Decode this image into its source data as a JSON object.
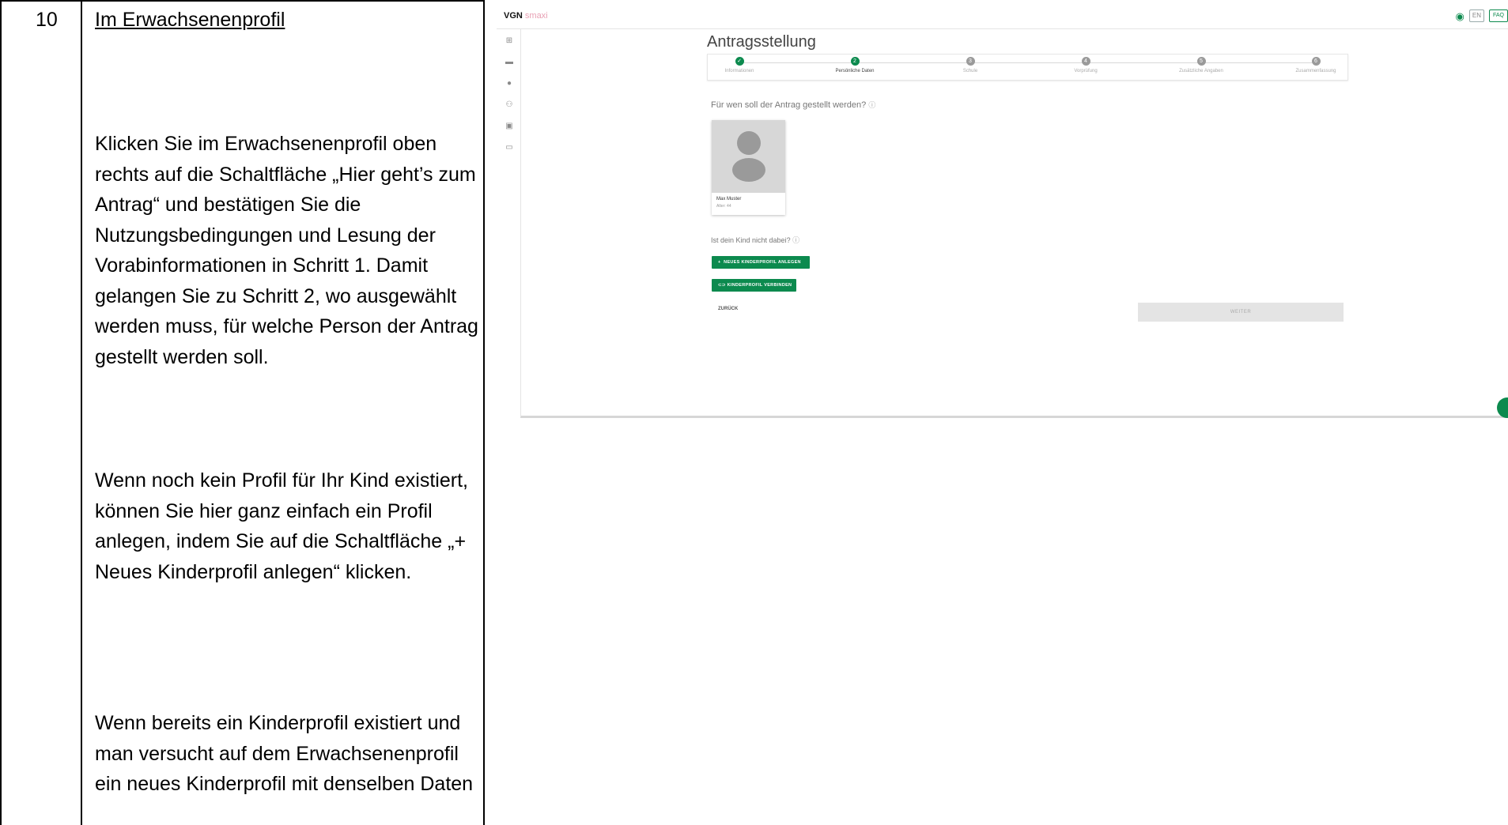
{
  "document": {
    "step_number": "10",
    "step_title": "Im Erwachsenenprofil",
    "paragraphs": [
      "Klicken Sie im Erwachsenenprofil oben rechts auf die Schaltfläche „Hier geht’s zum Antrag“ und bestätigen Sie die Nutzungsbedingungen und Lesung der Vorabinformationen in Schritt 1. Damit gelangen Sie zu Schritt 2, wo ausgewählt werden muss, für welche Person der Antrag gestellt werden soll.",
      "Wenn noch kein Profil für Ihr Kind existiert, können Sie hier ganz einfach ein Profil anlegen, indem Sie auf die Schaltfläche „+ Neues Kinderprofil anlegen“ klicken.",
      "Wenn bereits ein Kinderprofil existiert und man versucht auf dem Erwachsenenprofil ein neues Kinderprofil mit denselben Daten"
    ]
  },
  "app": {
    "brand_vgn": "VGN",
    "brand_smaxi": "smaxi",
    "lang_button": "EN",
    "faq_button": "FAQ",
    "page_title": "Antragsstellung",
    "stepper": [
      {
        "label": "Informationen",
        "marker": "✓",
        "state": "done"
      },
      {
        "label": "Persönliche Daten",
        "marker": "2",
        "state": "active"
      },
      {
        "label": "Schule",
        "marker": "3",
        "state": "pending"
      },
      {
        "label": "Vorprüfung",
        "marker": "4",
        "state": "pending"
      },
      {
        "label": "Zusätzliche Angaben",
        "marker": "5",
        "state": "pending"
      },
      {
        "label": "Zusammenfassung",
        "marker": "6",
        "state": "pending"
      }
    ],
    "question": "Für wen soll der Antrag gestellt werden?",
    "profile": {
      "name": "Max Muster",
      "age": "Alter: 44"
    },
    "question2": "Ist dein Kind nicht dabei?",
    "new_child_button": "NEUES KINDERPROFIL ANLEGEN",
    "link_child_button": "KINDERPROFIL VERBINDEN",
    "back_button": "ZURÜCK",
    "next_button": "WEITER",
    "colors": {
      "accent": "#0c8a4e",
      "brand_smaxi": "#e8a0b4"
    }
  }
}
